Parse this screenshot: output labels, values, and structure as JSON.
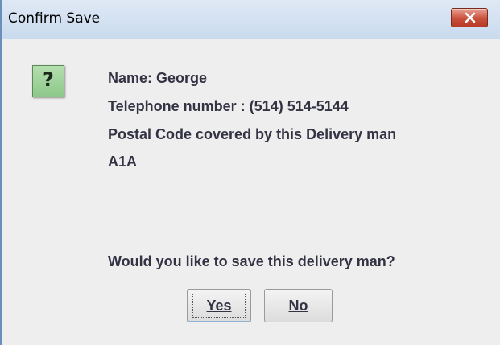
{
  "window": {
    "title": "Confirm Save"
  },
  "icons": {
    "question": "question-icon",
    "question_glyph": "?",
    "close": "close-icon"
  },
  "message": {
    "name": "Name: George",
    "telephone": "Telephone number : (514) 514-5144",
    "postal_label": "Postal Code covered by this Delivery man",
    "postal_value": "A1A",
    "question": "Would you like to save this delivery man?"
  },
  "buttons": {
    "yes": "Yes",
    "no": "No"
  },
  "colors": {
    "close_button": "#c9503b",
    "question_icon": "#8dc88a",
    "text": "#333344"
  }
}
